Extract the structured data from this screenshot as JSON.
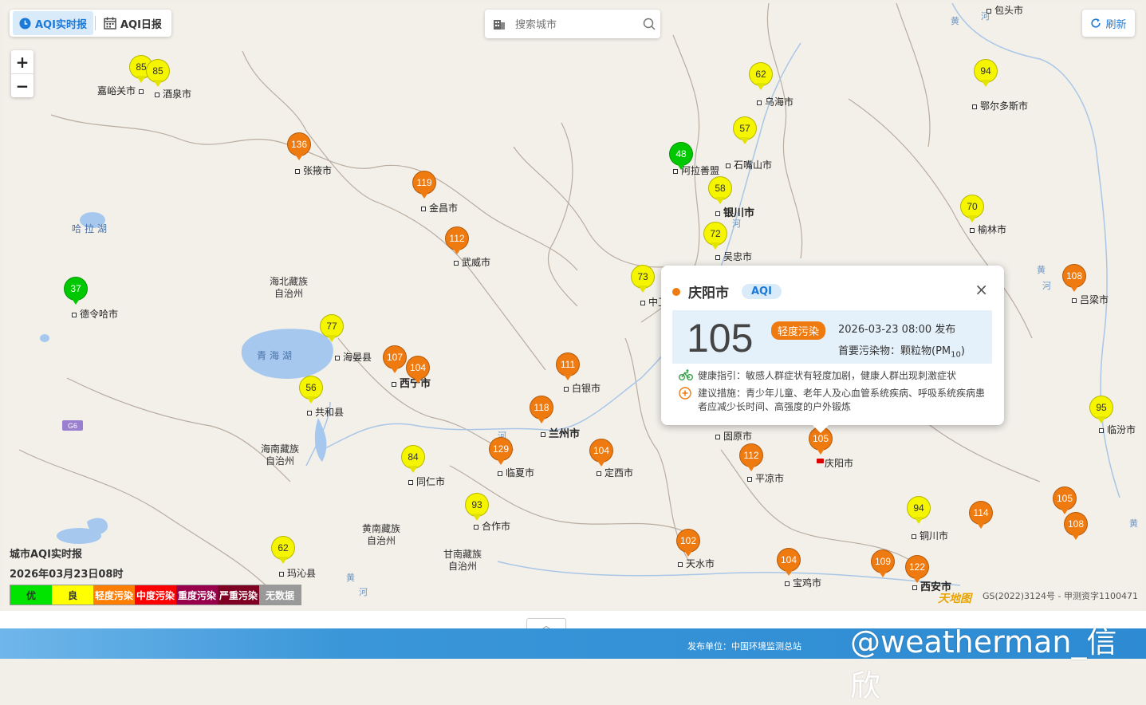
{
  "tabs": [
    {
      "label": "AQI实时报",
      "active": true,
      "icon": "clock-icon"
    },
    {
      "label": "AQI日报",
      "active": false,
      "icon": "calendar-icon"
    }
  ],
  "search": {
    "placeholder": "搜索城市"
  },
  "refresh_label": "刷新",
  "zoom": {
    "in": "+",
    "out": "−"
  },
  "colors": {
    "good": "#00c800",
    "moderate": "#f5f500",
    "light": "#ef7a10",
    "accent": "#1b7ad9"
  },
  "markers": [
    {
      "value": "85",
      "level": "moderate"
    },
    {
      "value": "85",
      "level": "moderate"
    },
    {
      "value": "136",
      "level": "light"
    },
    {
      "value": "119",
      "level": "light"
    },
    {
      "value": "112",
      "level": "light"
    },
    {
      "value": "37",
      "level": "good"
    },
    {
      "value": "77",
      "level": "moderate"
    },
    {
      "value": "107",
      "level": "light"
    },
    {
      "value": "104",
      "level": "light"
    },
    {
      "value": "56",
      "level": "moderate"
    },
    {
      "value": "111",
      "level": "light"
    },
    {
      "value": "118",
      "level": "light"
    },
    {
      "value": "129",
      "level": "light"
    },
    {
      "value": "104",
      "level": "light"
    },
    {
      "value": "84",
      "level": "moderate"
    },
    {
      "value": "93",
      "level": "moderate"
    },
    {
      "value": "62",
      "level": "moderate"
    },
    {
      "value": "102",
      "level": "light"
    },
    {
      "value": "104",
      "level": "light"
    },
    {
      "value": "109",
      "level": "light"
    },
    {
      "value": "122",
      "level": "light"
    },
    {
      "value": "62",
      "level": "moderate"
    },
    {
      "value": "57",
      "level": "moderate"
    },
    {
      "value": "48",
      "level": "good"
    },
    {
      "value": "58",
      "level": "moderate"
    },
    {
      "value": "72",
      "level": "moderate"
    },
    {
      "value": "73",
      "level": "moderate"
    },
    {
      "value": "94",
      "level": "moderate"
    },
    {
      "value": "70",
      "level": "moderate"
    },
    {
      "value": "108",
      "level": "light"
    },
    {
      "value": "95",
      "level": "moderate"
    },
    {
      "value": "105",
      "level": "light"
    },
    {
      "value": "108",
      "level": "light"
    },
    {
      "value": "114",
      "level": "light"
    },
    {
      "value": "94",
      "level": "moderate"
    },
    {
      "value": "112",
      "level": "light"
    },
    {
      "value": "105",
      "level": "light"
    }
  ],
  "cities": [
    "嘉峪关市",
    "酒泉市",
    "张掖市",
    "金昌市",
    "武威市",
    "德令哈市",
    "海晏县",
    "西宁市",
    "共和县",
    "白银市",
    "兰州市",
    "临夏市",
    "定西市",
    "同仁市",
    "合作市",
    "玛沁县",
    "天水市",
    "宝鸡市",
    "西安市",
    "乌海市",
    "石嘴山市",
    "阿拉善盟",
    "银川市",
    "吴忠市",
    "中卫市",
    "鄂尔多斯市",
    "榆林市",
    "吕梁市",
    "临汾市",
    "铜川市",
    "固原市",
    "平凉市",
    "庆阳市",
    "包头市"
  ],
  "regions": [
    "海北藏族\n自治州",
    "海南藏族\n自治州",
    "黄南藏族\n自治州",
    "甘南藏族\n自治州"
  ],
  "lakes": [
    "哈拉湖",
    "青海湖"
  ],
  "rivers": [
    "黄",
    "河",
    "黄",
    "河",
    "河",
    "黄",
    "河",
    "河",
    "黄"
  ],
  "road_sign": "G6",
  "popup": {
    "city": "庆阳市",
    "tag": "AQI",
    "aqi": "105",
    "level": "轻度污染",
    "time": "2026-03-23 08:00 发布",
    "primary_prefix": "首要污染物：颗粒物(PM",
    "primary_sub": "10",
    "primary_suffix": ")",
    "health": "健康指引：敏感人群症状有轻度加剧，健康人群出现刺激症状",
    "advice": "建议措施：青少年儿童、老年人及心血管系统疾病、呼吸系统疾病患者应减少长时间、高强度的户外锻炼",
    "close": "×"
  },
  "legend": {
    "title": "城市AQI实时报",
    "time": "2026年03月23日08时",
    "items": [
      {
        "label": "优",
        "color": "#00e400",
        "text": "#333"
      },
      {
        "label": "良",
        "color": "#ffff00",
        "text": "#333"
      },
      {
        "label": "轻度污染",
        "color": "#ff7e00",
        "text": "#fff"
      },
      {
        "label": "中度污染",
        "color": "#ff0000",
        "text": "#fff"
      },
      {
        "label": "重度污染",
        "color": "#99004c",
        "text": "#fff"
      },
      {
        "label": "严重污染",
        "color": "#7e0023",
        "text": "#fff"
      },
      {
        "label": "无数据",
        "color": "#999999",
        "text": "#fff"
      }
    ]
  },
  "copyright": "GS(2022)3124号 - 甲测资字1100471",
  "map_logo": "天地图",
  "footer": {
    "publisher": "发布单位：中国环境监测总站",
    "watermark": "@weatherman_信欣"
  }
}
